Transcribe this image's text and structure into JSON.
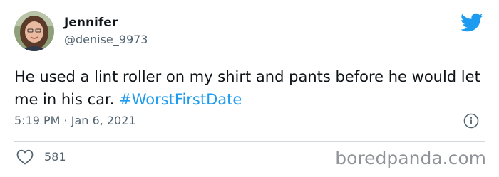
{
  "user": {
    "name": "Jennifer",
    "handle": "@denise_9973"
  },
  "tweet": {
    "text": "He used a lint roller on my shirt and pants before he would let me in his car.",
    "hashtag": "#WorstFirstDate",
    "timestamp": "5:19 PM · Jan 6, 2021"
  },
  "engagement": {
    "likes": "581"
  },
  "watermark": "boredpanda.com",
  "icons": {
    "brand": "twitter-bird-icon",
    "info": "info-icon",
    "like": "heart-icon"
  },
  "colors": {
    "accent": "#1d9bf0",
    "text": "#0f1419",
    "muted": "#536471",
    "divider": "#cfd9de"
  }
}
